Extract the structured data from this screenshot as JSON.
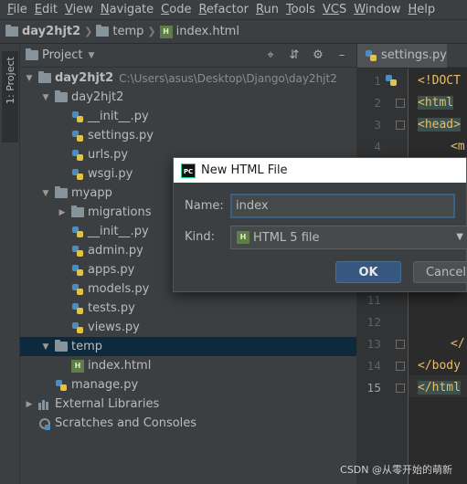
{
  "menu": {
    "items": [
      {
        "first": "F",
        "rest": "ile"
      },
      {
        "first": "E",
        "rest": "dit"
      },
      {
        "first": "V",
        "rest": "iew"
      },
      {
        "first": "N",
        "rest": "avigate"
      },
      {
        "first": "C",
        "rest": "ode"
      },
      {
        "first": "R",
        "rest": "efactor"
      },
      {
        "first": "R",
        "rest": "un"
      },
      {
        "first": "T",
        "rest": "ools"
      },
      {
        "first": "VC",
        "rest": "S"
      },
      {
        "first": "W",
        "rest": "indow"
      },
      {
        "first": "H",
        "rest": "elp"
      }
    ]
  },
  "breadcrumb": {
    "project": "day2hjt2",
    "folder": "temp",
    "file": "index.html"
  },
  "toolstrip": {
    "project_label": "1: Project"
  },
  "project_panel": {
    "title": "Project",
    "root_name": "day2hjt2",
    "root_path": "C:\\Users\\asus\\Desktop\\Django\\day2hjt2",
    "pkg_name": "day2hjt2",
    "pkg_files": [
      "__init__.py",
      "settings.py",
      "urls.py",
      "wsgi.py"
    ],
    "app_name": "myapp",
    "migrations": "migrations",
    "app_files": [
      "__init__.py",
      "admin.py",
      "apps.py",
      "models.py",
      "tests.py",
      "views.py"
    ],
    "temp_name": "temp",
    "temp_file": "index.html",
    "manage": "manage.py",
    "external_libs": "External Libraries",
    "scratches": "Scratches and Consoles"
  },
  "editor": {
    "tab_label": "settings.py",
    "line_numbers": [
      "1",
      "2",
      "3",
      "4",
      "11",
      "12",
      "13",
      "14",
      "15"
    ],
    "code": {
      "l1": "<!DOCT",
      "l2": "<html",
      "l3": "<head>",
      "l4": "<m",
      "l13": "</",
      "l14": "</body",
      "l15": "</html"
    }
  },
  "dialog": {
    "title": "New HTML File",
    "name_label": "Name:",
    "name_value": "index",
    "kind_label": "Kind:",
    "kind_value": "HTML 5 file",
    "ok_label": "OK",
    "cancel_label": "Cancel",
    "logo_text": "PC"
  },
  "watermark": "CSDN @从零开始的萌新"
}
